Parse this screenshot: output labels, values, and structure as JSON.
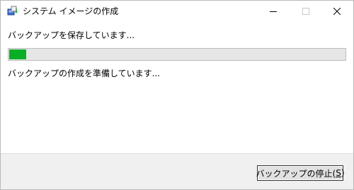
{
  "window": {
    "title": "システム イメージの作成",
    "icon": "backup-app-icon",
    "controls": {
      "minimize": "minimize-icon",
      "maximize": "maximize-icon",
      "close": "close-icon"
    }
  },
  "status": {
    "main": "バックアップを保存しています...",
    "detail": "バックアップの作成を準備しています..."
  },
  "progress": {
    "fraction": 0.05,
    "color": "#06b025"
  },
  "footer": {
    "stop_button": {
      "label": "バックアップの停止(",
      "mnemonic": "S",
      "label_end": ")"
    }
  }
}
